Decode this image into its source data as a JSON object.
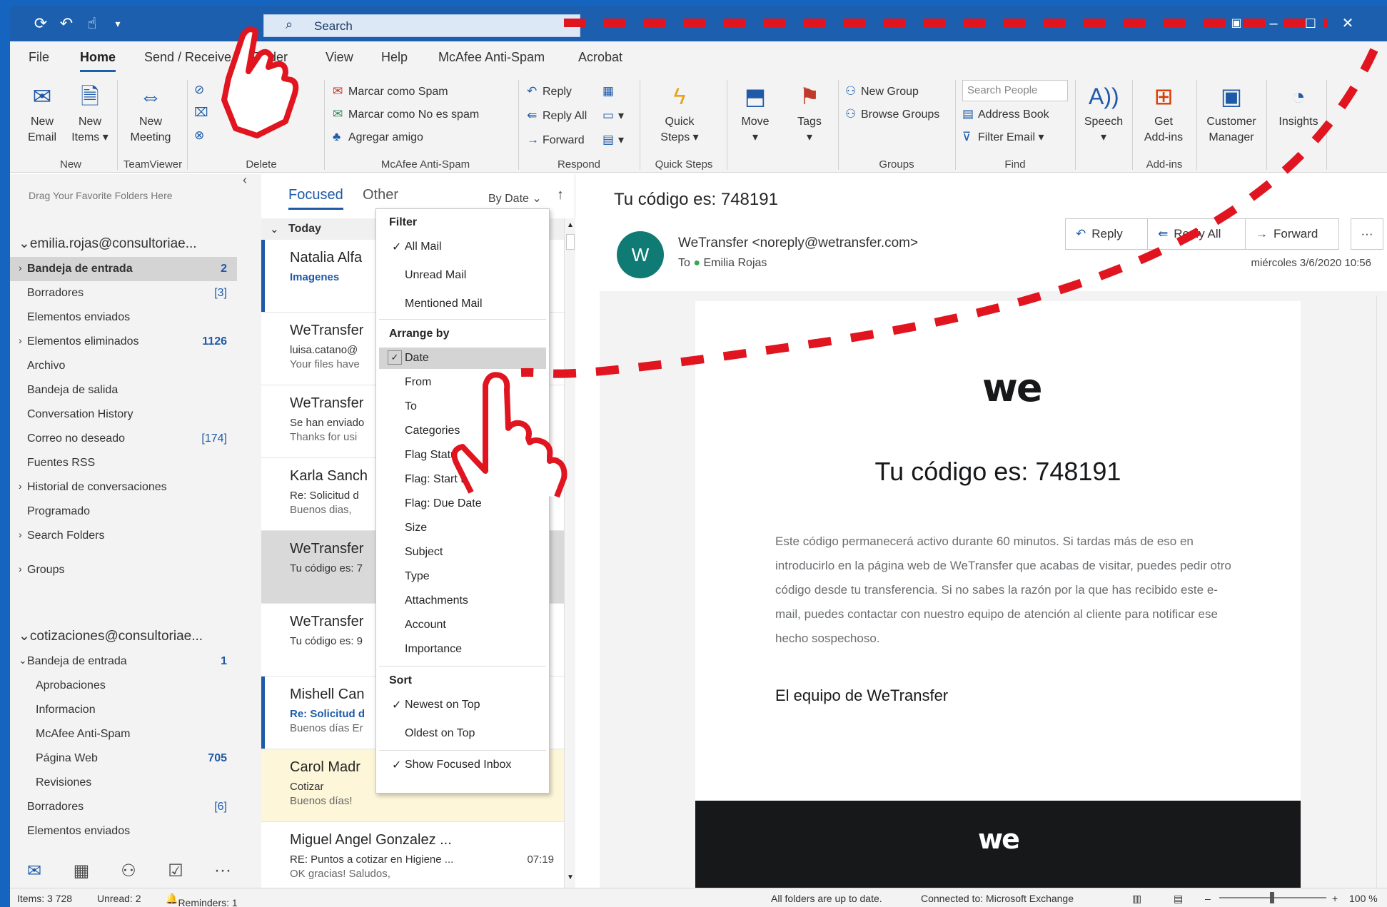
{
  "titlebar": {
    "search_placeholder": "Search"
  },
  "menu": {
    "tabs": [
      "File",
      "Home",
      "Send / Receive",
      "Folder",
      "View",
      "Help",
      "McAfee Anti-Spam",
      "Acrobat"
    ]
  },
  "ribbon": {
    "new_email": [
      "New",
      "Email"
    ],
    "new_items": [
      "New",
      "Items"
    ],
    "new_meeting": [
      "New",
      "Meeting"
    ],
    "groups": [
      "New",
      "TeamViewer",
      "Delete",
      "McAfee Anti-Spam",
      "Respond",
      "Quick Steps",
      "Groups",
      "Find",
      "Add-ins"
    ],
    "mcafee": [
      "Marcar como Spam",
      "Marcar como No es spam",
      "Agregar amigo"
    ],
    "respond": [
      "Reply",
      "Reply All",
      "Forward"
    ],
    "quick_steps": [
      "Quick",
      "Steps"
    ],
    "move": "Move",
    "tags": "Tags",
    "new_group": "New Group",
    "browse_groups": "Browse Groups",
    "search_people": "Search People",
    "address_book": "Address Book",
    "filter_email": "Filter Email",
    "speech": "Speech",
    "get_addins": [
      "Get",
      "Add-ins"
    ],
    "customer_manager": [
      "Customer",
      "Manager"
    ],
    "insights": "Insights"
  },
  "folders": {
    "drag_hint": "Drag Your Favorite Folders Here",
    "account1": "emilia.rojas@consultoriae...",
    "account1_items": [
      {
        "label": "Bandeja de entrada",
        "count": "2"
      },
      {
        "label": "Borradores",
        "count": "[3]"
      },
      {
        "label": "Elementos enviados",
        "count": ""
      },
      {
        "label": "Elementos eliminados",
        "count": "1126"
      },
      {
        "label": "Archivo",
        "count": ""
      },
      {
        "label": "Bandeja de salida",
        "count": ""
      },
      {
        "label": "Conversation History",
        "count": ""
      },
      {
        "label": "Correo no deseado",
        "count": "[174]"
      },
      {
        "label": "Fuentes RSS",
        "count": ""
      },
      {
        "label": "Historial de conversaciones",
        "count": ""
      },
      {
        "label": "Programado",
        "count": ""
      },
      {
        "label": "Search Folders",
        "count": ""
      },
      {
        "label": "Groups",
        "count": ""
      }
    ],
    "account2": "cotizaciones@consultoriae...",
    "account2_items": [
      {
        "label": "Bandeja de entrada",
        "count": "1"
      },
      {
        "label": "Aprobaciones",
        "count": ""
      },
      {
        "label": "Informacion",
        "count": ""
      },
      {
        "label": "McAfee Anti-Spam",
        "count": ""
      },
      {
        "label": "Página Web",
        "count": "705"
      },
      {
        "label": "Revisiones",
        "count": ""
      },
      {
        "label": "Borradores",
        "count": "[6]"
      },
      {
        "label": "Elementos enviados",
        "count": ""
      }
    ]
  },
  "msglist": {
    "tab_focused": "Focused",
    "tab_other": "Other",
    "sort": "By Date",
    "group_today": "Today",
    "items": [
      {
        "sender": "Natalia Alfa",
        "subject": "Imagenes",
        "preview": "",
        "time": ""
      },
      {
        "sender": "WeTransfer",
        "subject": "luisa.catano@",
        "preview": "Your files have",
        "time": ""
      },
      {
        "sender": "WeTransfer",
        "subject": "Se han enviado",
        "preview": "Thanks for usi",
        "time": ""
      },
      {
        "sender": "Karla Sanch",
        "subject": "Re: Solicitud d",
        "preview": "Buenos dias,",
        "time": ""
      },
      {
        "sender": "WeTransfer",
        "subject": "Tu código es: 7",
        "preview": "",
        "time": ""
      },
      {
        "sender": "WeTransfer",
        "subject": "Tu código es: 9",
        "preview": "",
        "time": ""
      },
      {
        "sender": "Mishell Can",
        "subject": "Re: Solicitud d",
        "preview": "Buenos días Er",
        "time": ""
      },
      {
        "sender": "Carol Madr",
        "subject": "Cotizar",
        "preview": "Buenos días!",
        "time": ""
      },
      {
        "sender": "Miguel Angel Gonzalez ...",
        "subject": "RE: Puntos a cotizar en Higiene ...",
        "preview": "OK gracias! Saludos,",
        "time": "07:19"
      }
    ]
  },
  "dropdown": {
    "filter_head": "Filter",
    "filter_items": [
      "All Mail",
      "Unread Mail",
      "Mentioned Mail"
    ],
    "arrange_head": "Arrange by",
    "arrange_items": [
      "Date",
      "From",
      "To",
      "Categories",
      "Flag Status",
      "Flag: Start Date",
      "Flag: Due Date",
      "Size",
      "Subject",
      "Type",
      "Attachments",
      "Account",
      "Importance"
    ],
    "sort_head": "Sort",
    "sort_items": [
      "Newest on Top",
      "Oldest on Top",
      "Show Focused Inbox"
    ]
  },
  "reading": {
    "subject": "Tu código es: 748191",
    "reply": "Reply",
    "reply_all": "Reply All",
    "forward": "Forward",
    "avatar": "W",
    "from": "WeTransfer <noreply@wetransfer.com>",
    "to_label": "To",
    "to_name": "Emilia Rojas",
    "date": "miércoles 3/6/2020 10:56",
    "logo": "we",
    "code_title": "Tu código es: 748191",
    "body": "Este código permanecerá activo durante 60 minutos. Si tardas más de eso en introducirlo en la página web de WeTransfer que acabas de visitar, puedes pedir otro código desde tu transferencia.   Si no sabes la razón por la que has recibido este e-mail, puedes contactar con nuestro equipo de atención al cliente para notificar ese hecho sospechoso.",
    "signoff": "El equipo de WeTransfer"
  },
  "status": {
    "items": "Items: 3 728",
    "unread": "Unread: 2",
    "reminders": "Reminders: 1",
    "uptodate": "All folders are up to date.",
    "connected": "Connected to: Microsoft Exchange",
    "zoom": "100 %"
  },
  "colors": {
    "accent": "#1b5fae",
    "annotation": "#e0151f"
  }
}
